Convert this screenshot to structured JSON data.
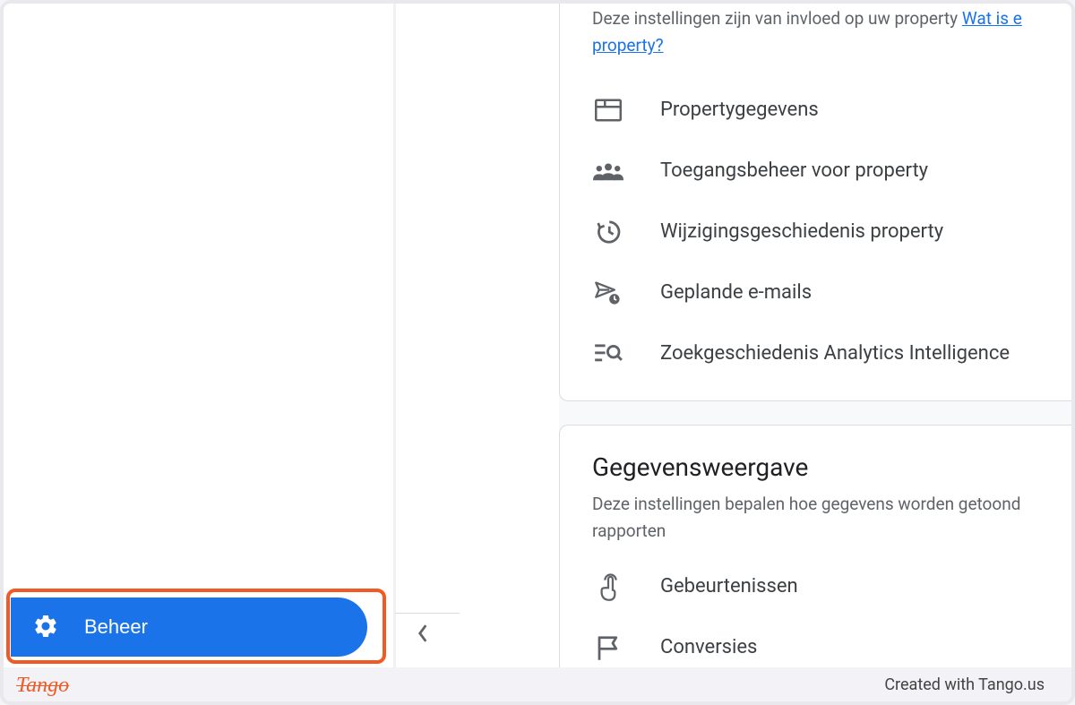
{
  "sidebar": {
    "beheer_label": "Beheer"
  },
  "property_section": {
    "description_part1": "Deze instellingen zijn van invloed op uw property",
    "help_link_part1": "Wat is e",
    "help_link_part2": "property?",
    "items": [
      {
        "label": "Propertygegevens",
        "icon": "web-icon"
      },
      {
        "label": "Toegangsbeheer voor property",
        "icon": "people-icon"
      },
      {
        "label": "Wijzigingsgeschiedenis property",
        "icon": "history-icon"
      },
      {
        "label": "Geplande e-mails",
        "icon": "send-schedule-icon"
      },
      {
        "label": "Zoekgeschiedenis Analytics Intelligence",
        "icon": "search-list-icon"
      }
    ]
  },
  "data_display_section": {
    "title": "Gegevensweergave",
    "description": "Deze instellingen bepalen hoe gegevens worden getoond rapporten",
    "items": [
      {
        "label": "Gebeurtenissen",
        "icon": "touch-icon"
      },
      {
        "label": "Conversies",
        "icon": "flag-icon"
      }
    ]
  },
  "footer": {
    "logo_text": "Tango",
    "credit_text": "Created with Tango.us"
  }
}
